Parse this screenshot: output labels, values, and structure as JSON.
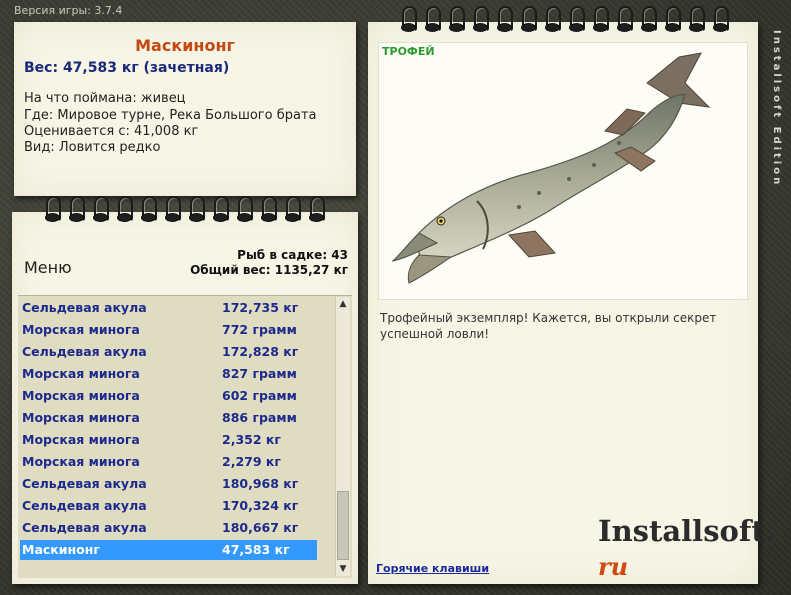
{
  "version_label": "Версия игры: 3.7.4",
  "side_watermark": "Installsoft Edition",
  "info": {
    "title": "Маскинонг",
    "weight": "Вес: 47,583 кг (зачетная)",
    "caught_on": "На что поймана: живец",
    "where": "Где: Мировое турне, Река Большого брата",
    "valued_from": "Оценивается с: 41,008 кг",
    "kind": "Вид: Ловится редко"
  },
  "menu": {
    "title": "Меню",
    "fish_in_keepnet": "Рыб в садке: 43",
    "total_weight": "Общий вес: 1135,27 кг"
  },
  "catch_list": [
    {
      "name": "Сельдевая акула",
      "weight": "172,735 кг"
    },
    {
      "name": "Морская минога",
      "weight": "772 грамм"
    },
    {
      "name": "Сельдевая акула",
      "weight": "172,828 кг"
    },
    {
      "name": "Морская минога",
      "weight": "827 грамм"
    },
    {
      "name": "Морская минога",
      "weight": "602 грамм"
    },
    {
      "name": "Морская минога",
      "weight": "886 грамм"
    },
    {
      "name": "Морская минога",
      "weight": "2,352 кг"
    },
    {
      "name": "Морская минога",
      "weight": "2,279 кг"
    },
    {
      "name": "Сельдевая акула",
      "weight": "180,968 кг"
    },
    {
      "name": "Сельдевая акула",
      "weight": "170,324 кг"
    },
    {
      "name": "Сельдевая акула",
      "weight": "180,667 кг"
    },
    {
      "name": "Маскинонг",
      "weight": "47,583 кг",
      "selected": true
    }
  ],
  "trophy": {
    "badge": "ТРОФЕЙ",
    "description": "Трофейный экземпляр! Кажется, вы открыли секрет успешной ловли!",
    "hotkeys_link": "Горячие клавиши",
    "logo_main": "Installsoft.",
    "logo_suffix": "ru"
  },
  "colors": {
    "title": "#c24a10",
    "list_text": "#1c2a8c",
    "selection": "#3399ff",
    "trophy_badge": "#2a9a2a"
  }
}
